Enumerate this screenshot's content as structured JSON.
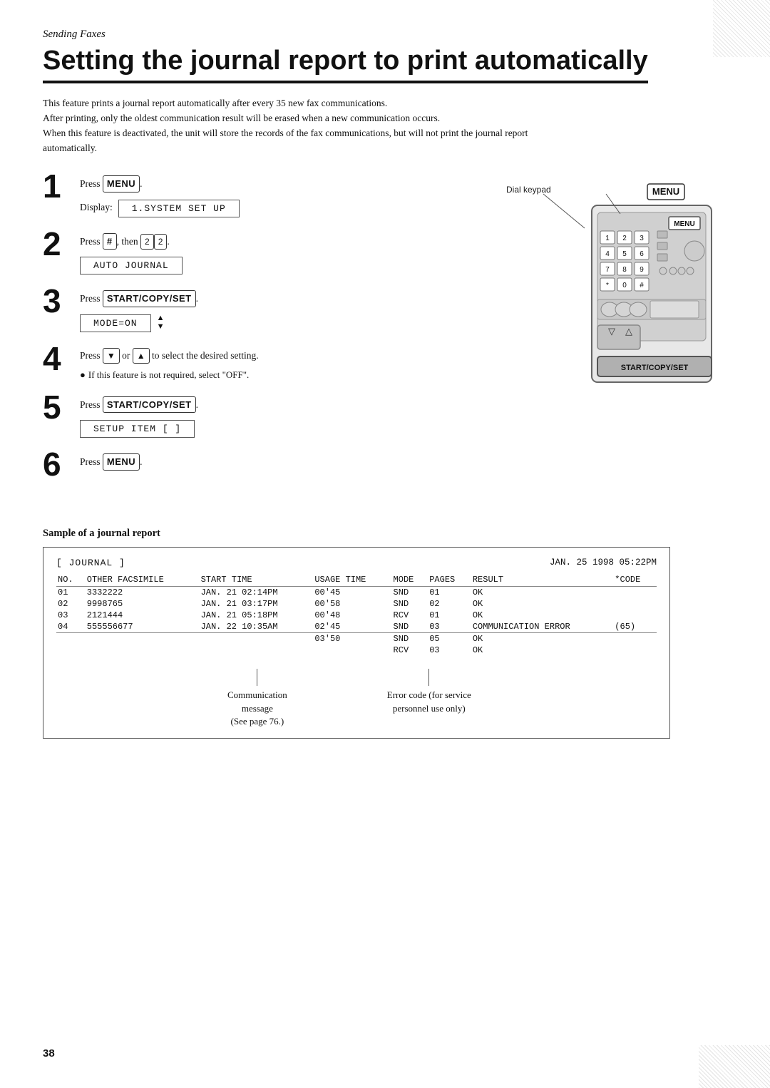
{
  "page": {
    "section_label": "Sending Faxes",
    "title": "Setting the journal report to print automatically",
    "intro": [
      "This feature prints a journal report automatically after every 35 new fax communications.",
      "After printing, only the oldest communication result will be erased when a new communication occurs.",
      "When this feature is deactivated, the unit will store the records of the fax communications, but will not print the journal report automatically."
    ],
    "steps": [
      {
        "number": "1",
        "instruction": "Press [MENU].",
        "display_label": "Display:",
        "display_value": "1.SYSTEM SET UP"
      },
      {
        "number": "2",
        "instruction": "Press [#], then [2][2].",
        "display_value": "AUTO JOURNAL"
      },
      {
        "number": "3",
        "instruction": "Press [START/COPY/SET].",
        "display_value": "MODE=ON",
        "has_arrows": true
      },
      {
        "number": "4",
        "instruction": "Press [▼] or [▲] to select the desired setting.",
        "note": "• If this feature is not required, select \"OFF\"."
      },
      {
        "number": "5",
        "instruction": "Press [START/COPY/SET].",
        "display_value": "SETUP ITEM [    ]"
      },
      {
        "number": "6",
        "instruction": "Press [MENU]."
      }
    ],
    "device": {
      "labels": {
        "dial_keypad": "Dial keypad",
        "menu_button": "MENU",
        "start_button": "START/COPY/SET"
      }
    },
    "journal": {
      "section_title": "Sample of a journal report",
      "title_tag": "[ JOURNAL ]",
      "date": "JAN. 25 1998 05:22PM",
      "columns": [
        "NO.",
        "OTHER FACSIMILE",
        "START TIME",
        "USAGE TIME",
        "MODE",
        "PAGES",
        "RESULT",
        "*CODE"
      ],
      "rows": [
        {
          "no": "01",
          "other": "3332222",
          "start": "JAN. 21 02:14PM",
          "usage": "00'45",
          "mode": "SND",
          "pages": "01",
          "result": "OK",
          "code": ""
        },
        {
          "no": "02",
          "other": "9998765",
          "start": "JAN. 21 03:17PM",
          "usage": "00'58",
          "mode": "SND",
          "pages": "02",
          "result": "OK",
          "code": ""
        },
        {
          "no": "03",
          "other": "2121444",
          "start": "JAN. 21 05:18PM",
          "usage": "00'48",
          "mode": "RCV",
          "pages": "01",
          "result": "OK",
          "code": ""
        },
        {
          "no": "04",
          "other": "555556677",
          "start": "JAN. 22 10:35AM",
          "usage": "02'45",
          "mode": "SND",
          "pages": "03",
          "result": "COMMUNICATION ERROR",
          "code": "(65)"
        },
        {
          "no": "",
          "other": "",
          "start": "",
          "usage": "03'50",
          "mode": "SND",
          "pages": "05",
          "result": "OK",
          "code": ""
        },
        {
          "no": "",
          "other": "",
          "start": "",
          "usage": "",
          "mode": "RCV",
          "pages": "03",
          "result": "OK",
          "code": ""
        }
      ],
      "annotations": [
        {
          "id": "comm-message",
          "text": "Communication\nmessage\n(See page 76.)"
        },
        {
          "id": "error-code",
          "text": "Error code (for service\npersonnel use only)"
        }
      ]
    },
    "page_number": "38"
  }
}
